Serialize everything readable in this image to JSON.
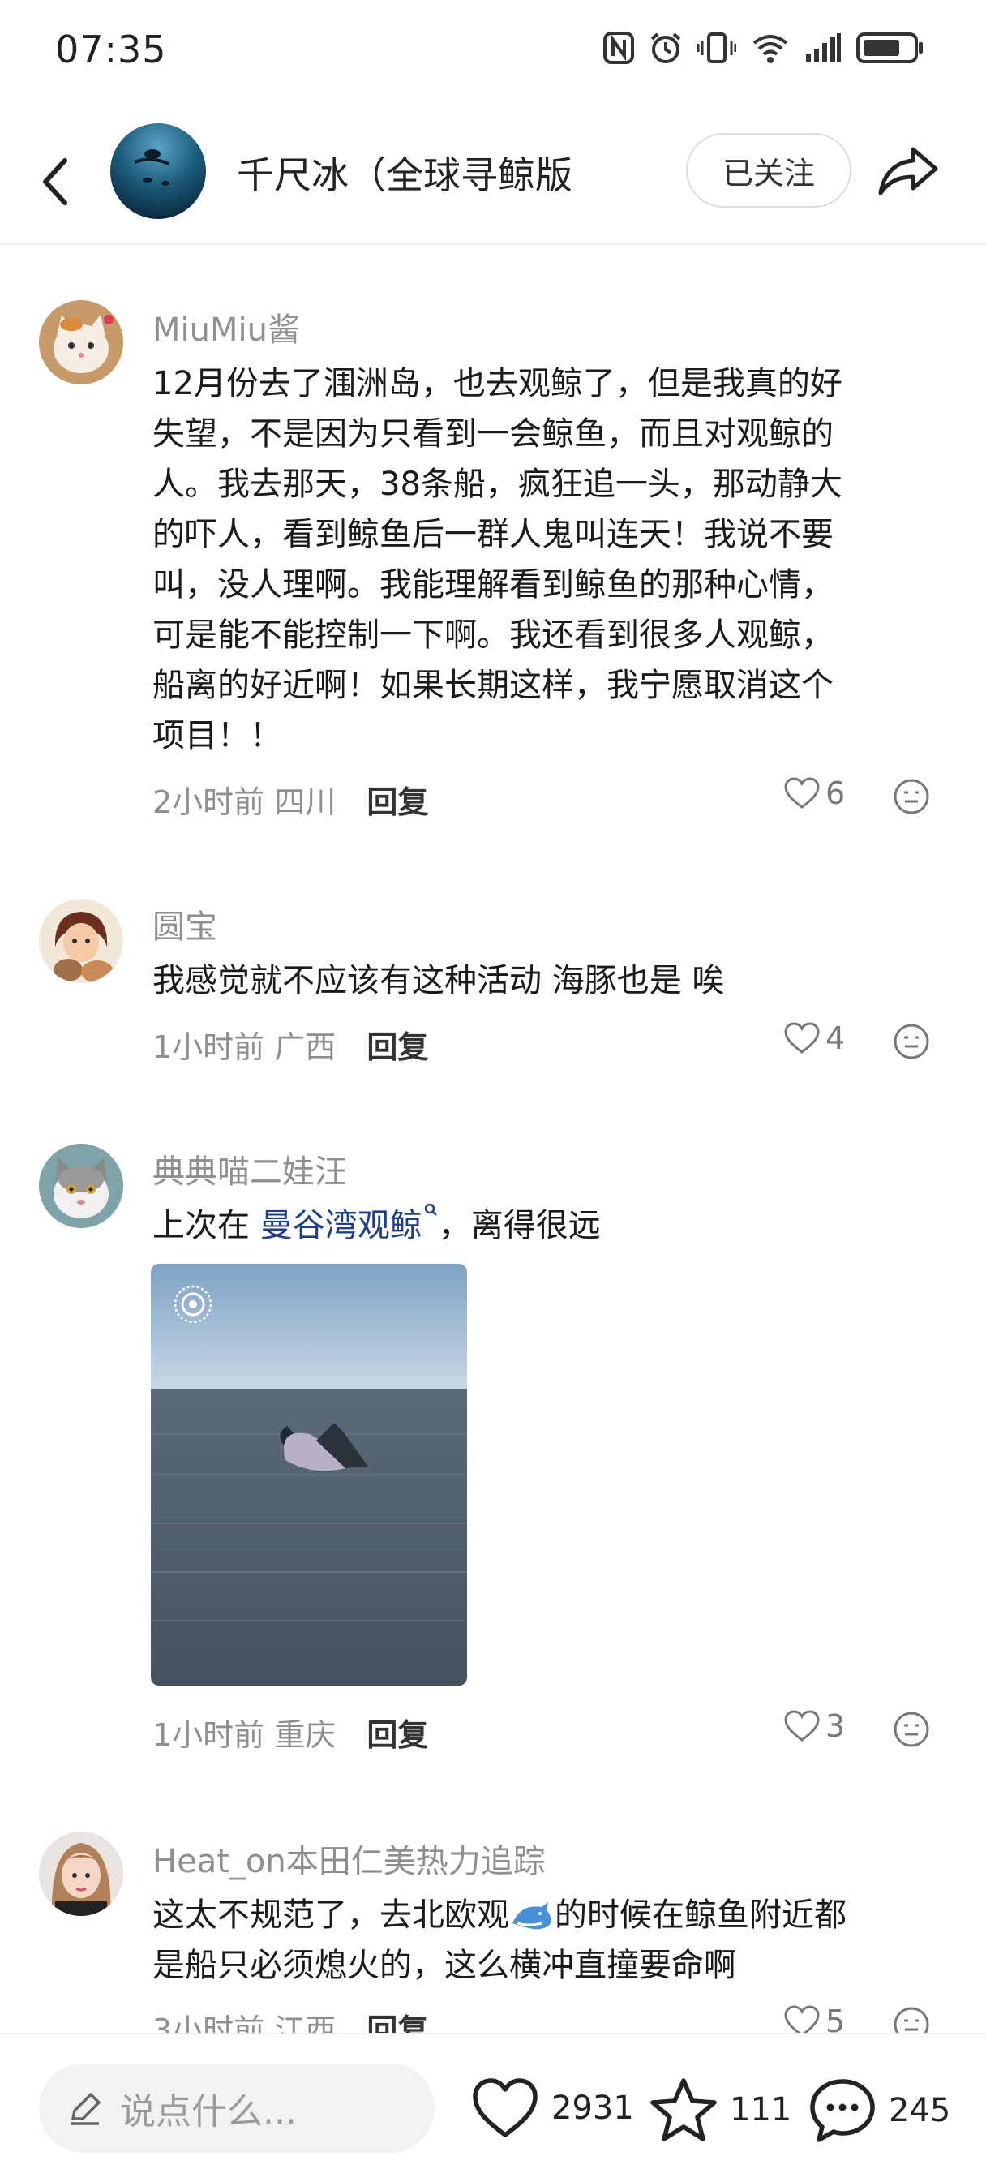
{
  "status_bar": {
    "time": "07:35"
  },
  "header": {
    "title": "千尺冰（全球寻鲸版",
    "follow_label": "已关注"
  },
  "comments": [
    {
      "name": "MiuMiu酱",
      "lines": [
        "12月份去了涠洲岛，也去观鲸了，但是我真的好",
        "失望，不是因为只看到一会鲸鱼，而且对观鲸的",
        "人。我去那天，38条船，疯狂追一头，那动静大",
        "的吓人，看到鲸鱼后一群人鬼叫连天！我说不要",
        "叫，没人理啊。我能理解看到鲸鱼的那种心情，",
        "可是能不能控制一下啊。我还看到很多人观鲸，",
        "船离的好近啊！如果长期这样，我宁愿取消这个",
        "项目！！"
      ],
      "time": "2小时前",
      "location": "四川",
      "reply": "回复",
      "likes": "6"
    },
    {
      "name": "圆宝",
      "lines": [
        "我感觉就不应该有这种活动 海豚也是 唉"
      ],
      "time": "1小时前",
      "location": "广西",
      "reply": "回复",
      "likes": "4"
    },
    {
      "name": "典典喵二娃汪",
      "text_prefix": "上次在 ",
      "link": "曼谷湾观鲸",
      "text_suffix": "，离得很远",
      "time": "1小时前",
      "location": "重庆",
      "reply": "回复",
      "likes": "3"
    },
    {
      "name": "Heat_on本田仁美热力追踪",
      "line1_a": "这太不规范了，去北欧观",
      "line1_b": "的时候在鲸鱼附近都",
      "line2": "是船只必须熄火的，这么横冲直撞要命啊",
      "time": "3小时前",
      "location": "江西",
      "reply": "回复",
      "likes": "5"
    }
  ],
  "bottom_bar": {
    "input_placeholder": "说点什么...",
    "likes": "2931",
    "favorites": "111",
    "comments": "245"
  },
  "colors": {
    "link": "#1e3f8c",
    "meta_gray": "#8f8f8f"
  },
  "icons": [
    "back-icon",
    "share-icon",
    "heart-icon",
    "smile-icon",
    "star-icon",
    "chat-icon",
    "pencil-icon",
    "live-photo-icon",
    "search-icon",
    "dolphin-emoji"
  ]
}
